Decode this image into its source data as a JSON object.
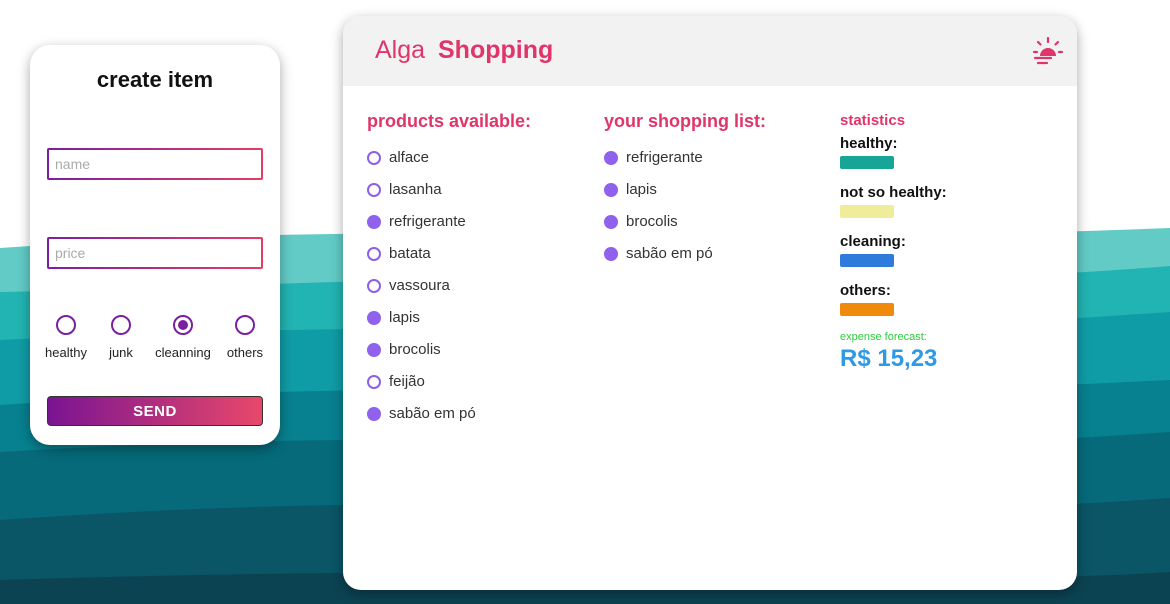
{
  "create_item": {
    "title": "create item",
    "name_placeholder": "name",
    "price_placeholder": "price",
    "categories": [
      {
        "label": "healthy",
        "checked": false
      },
      {
        "label": "junk",
        "checked": false
      },
      {
        "label": "cleanning",
        "checked": true
      },
      {
        "label": "others",
        "checked": false
      }
    ],
    "send_label": "SEND"
  },
  "header": {
    "brand_light": "Alga",
    "brand_bold": "Shopping",
    "theme_icon": "sunset-icon"
  },
  "products": {
    "title": "products available:",
    "items": [
      {
        "label": "alface",
        "selected": false
      },
      {
        "label": "lasanha",
        "selected": false
      },
      {
        "label": "refrigerante",
        "selected": true
      },
      {
        "label": "batata",
        "selected": false
      },
      {
        "label": "vassoura",
        "selected": false
      },
      {
        "label": "lapis",
        "selected": true
      },
      {
        "label": "brocolis",
        "selected": true
      },
      {
        "label": "feijão",
        "selected": false
      },
      {
        "label": "sabão em pó",
        "selected": true
      }
    ]
  },
  "shopping_list": {
    "title": "your shopping list:",
    "items": [
      "refrigerante",
      "lapis",
      "brocolis",
      "sabão em pó"
    ]
  },
  "statistics": {
    "title": "statistics",
    "items": [
      {
        "label": "healthy:",
        "color": "#16a596"
      },
      {
        "label": "not so healthy:",
        "color": "#f0ed9a"
      },
      {
        "label": "cleaning:",
        "color": "#2f7bdc"
      },
      {
        "label": "others:",
        "color": "#f08a0c"
      }
    ],
    "forecast_label": "expense forecast:",
    "forecast_value": "R$ 15,23"
  },
  "colors": {
    "accent": "#e0356a",
    "radio": "#7a1fa2",
    "dot": "#9061ec",
    "forecast": "#2e9ae6",
    "forecast_label": "#2ecc40"
  }
}
